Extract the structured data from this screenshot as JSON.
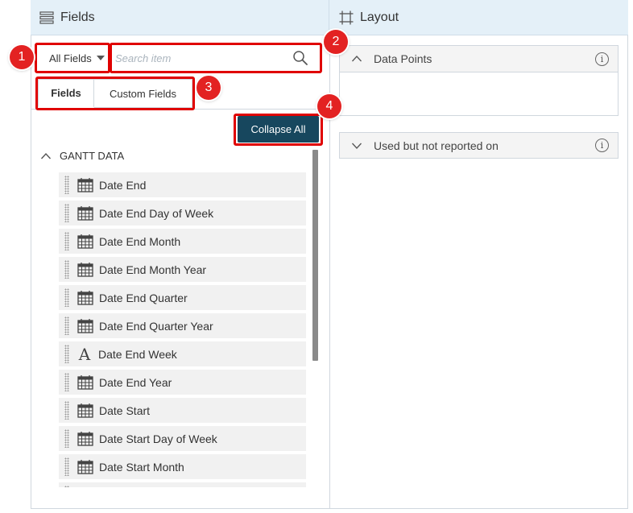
{
  "fields_panel": {
    "title": "Fields",
    "scope_dropdown": {
      "selected": "All Fields"
    },
    "search": {
      "placeholder": "Search item",
      "value": ""
    },
    "tabs": [
      {
        "label": "Fields",
        "active": true
      },
      {
        "label": "Custom Fields",
        "active": false
      }
    ],
    "collapse_all_label": "Collapse All",
    "group": {
      "label": "GANTT DATA",
      "expanded": true,
      "items": [
        {
          "label": "Date End",
          "icon": "calendar-icon"
        },
        {
          "label": "Date End Day of Week",
          "icon": "calendar-icon"
        },
        {
          "label": "Date End Month",
          "icon": "calendar-icon"
        },
        {
          "label": "Date End Month Year",
          "icon": "calendar-icon"
        },
        {
          "label": "Date End Quarter",
          "icon": "calendar-icon"
        },
        {
          "label": "Date End Quarter Year",
          "icon": "calendar-icon"
        },
        {
          "label": "Date End Week",
          "icon": "text-type-icon"
        },
        {
          "label": "Date End Year",
          "icon": "calendar-icon"
        },
        {
          "label": "Date Start",
          "icon": "calendar-icon"
        },
        {
          "label": "Date Start Day of Week",
          "icon": "calendar-icon"
        },
        {
          "label": "Date Start Month",
          "icon": "calendar-icon"
        },
        {
          "label": "",
          "icon": "calendar-icon"
        }
      ]
    }
  },
  "layout_panel": {
    "title": "Layout",
    "sections": [
      {
        "label": "Data Points",
        "expanded": true,
        "info": "i"
      },
      {
        "label": "Used but not reported on",
        "expanded": false,
        "info": "i"
      }
    ]
  },
  "annotations": {
    "badges": [
      "1",
      "2",
      "3",
      "4"
    ],
    "highlight_color": "#e00000"
  },
  "colors": {
    "header_bg": "#e4f0f8",
    "primary_button": "#17475e",
    "field_row_bg": "#f1f1f1"
  }
}
